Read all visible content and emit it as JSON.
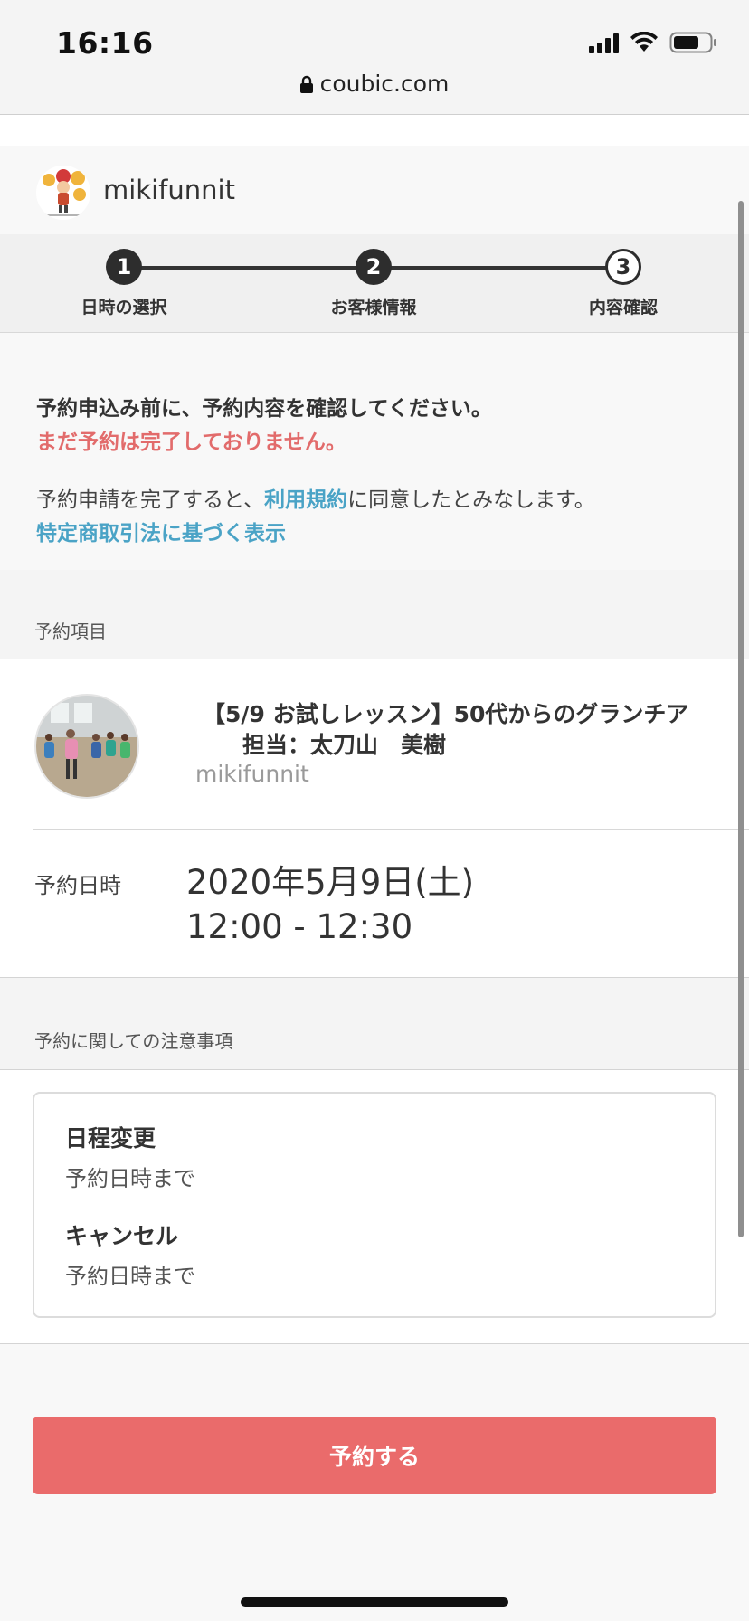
{
  "status_bar": {
    "time": "16:16"
  },
  "browser": {
    "url": "coubic.com"
  },
  "shop": {
    "name": "mikifunnit"
  },
  "stepper": {
    "steps": [
      {
        "number": "1",
        "label": "日時の選択"
      },
      {
        "number": "2",
        "label": "お客様情報"
      },
      {
        "number": "3",
        "label": "内容確認"
      }
    ]
  },
  "notice": {
    "confirm_text": "予約申込み前に、予約内容を確認してください。",
    "warning_text": "まだ予約は完了しておりません。",
    "terms_prefix": "予約申請を完了すると、",
    "terms_link": "利用規約",
    "terms_suffix": "に同意したとみなします。",
    "law_link": "特定商取引法に基づく表示"
  },
  "reservation": {
    "section_label": "予約項目",
    "title_line1": "【5/9 お試しレッスン】50代からのグランチア",
    "title_line2": "担当：太刀山　美樹",
    "shop": "mikifunnit",
    "datetime_label": "予約日時",
    "date": "2020年5月9日(土)",
    "time": "12:00 - 12:30"
  },
  "rules": {
    "section_label": "予約に関しての注意事項",
    "reschedule_heading": "日程変更",
    "reschedule_value": "予約日時まで",
    "cancel_heading": "キャンセル",
    "cancel_value": "予約日時まで"
  },
  "actions": {
    "submit_label": "予約する"
  },
  "colors": {
    "accent_red": "#ea6b6b",
    "warning_red": "#e26b6b",
    "link_blue": "#4aa3c6"
  }
}
